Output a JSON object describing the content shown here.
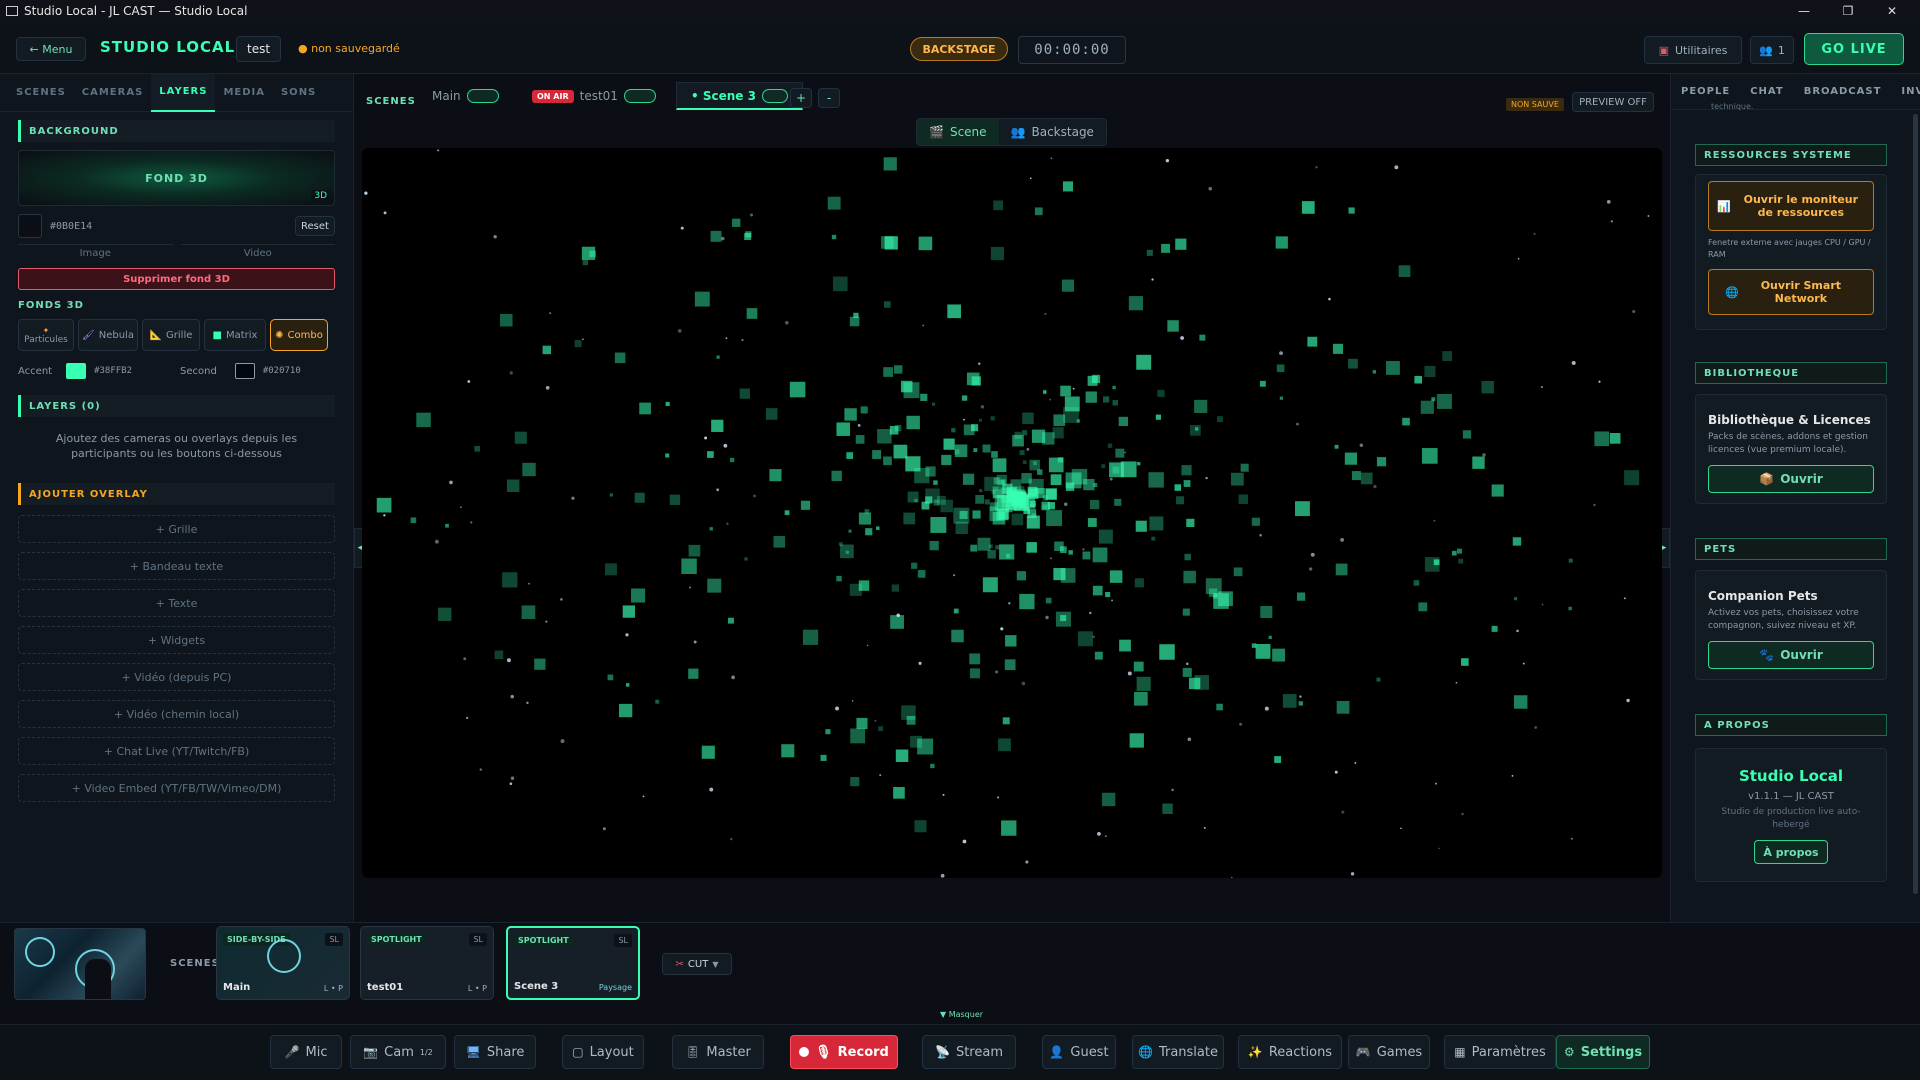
{
  "window": {
    "title": "Studio Local - JL CAST — Studio Local"
  },
  "topbar": {
    "menu_label": "← Menu",
    "brand": "STUDIO LOCAL",
    "project": "test",
    "save_status": "● non sauvegardé",
    "backstage": "BACKSTAGE",
    "timer": "00:00:00",
    "utilities": "Utilitaires",
    "people_count": "1",
    "go_live": "GO LIVE"
  },
  "left": {
    "tabs": [
      "SCENES",
      "CAMERAS",
      "LAYERS",
      "MEDIA",
      "SONS"
    ],
    "active_tab": "LAYERS",
    "background_header": "BACKGROUND",
    "bg_preview_label": "FOND 3D",
    "bg_preview_badge": "3D",
    "bg_color_hex": "#0B0E14",
    "reset_label": "Reset",
    "image_label": "Image",
    "video_label": "Video",
    "remove_3d": "Supprimer fond 3D",
    "fonds_header": "FONDS 3D",
    "fonds": [
      "Particules",
      "Nebula",
      "Grille",
      "Matrix",
      "Combo"
    ],
    "accent_label": "Accent",
    "accent_hex": "#38FFB2",
    "second_label": "Second",
    "second_hex": "#020710",
    "layers_header": "LAYERS (0)",
    "layers_empty": "Ajoutez des cameras ou overlays depuis les participants ou les boutons ci-dessous",
    "overlay_header": "AJOUTER OVERLAY",
    "overlays": [
      "+ Grille",
      "+ Bandeau texte",
      "+ Texte",
      "+ Widgets",
      "+ Vidéo (depuis PC)",
      "+ Vidéo (chemin local)",
      "+ Chat Live (YT/Twitch/FB)",
      "+ Video Embed (YT/FB/TW/Vimeo/DM)"
    ]
  },
  "center": {
    "scenes_label": "SCENES",
    "scene_tabs": [
      {
        "name": "Main"
      },
      {
        "name": "test01",
        "on_air": "ON AIR"
      },
      {
        "name": "• Scene 3"
      }
    ],
    "add_label": "+",
    "remove_label": "-",
    "non_sauve": "NON SAUVE",
    "preview_off": "PREVIEW OFF",
    "toggle_scene": "Scene",
    "toggle_backstage": "Backstage"
  },
  "right": {
    "tabs": [
      "PEOPLE",
      "CHAT",
      "BROADCAST",
      "INVIT"
    ],
    "top_snippet": "technique.",
    "res_header": "RESSOURCES SYSTEME",
    "monitor_btn": "Ouvrir le moniteur de ressources",
    "monitor_desc": "Fenetre externe avec jauges CPU / GPU / RAM",
    "smart_network_btn": "Ouvrir Smart Network",
    "lib_header": "BIBLIOTHEQUE",
    "lib_title": "Bibliothèque & Licences",
    "lib_desc": "Packs de scènes, addons et gestion licences (vue premium locale).",
    "open_label": "Ouvrir",
    "pets_header": "PETS",
    "pets_title": "Companion Pets",
    "pets_desc": "Activez vos pets, choisissez votre compagnon, suivez niveau et XP.",
    "about_header": "A PROPOS",
    "about_title": "Studio Local",
    "about_version": "v1.1.1 — JL CAST",
    "about_desc": "Studio de production live auto-hebergé",
    "about_btn": "À propos"
  },
  "strip": {
    "scenes_label": "SCENES",
    "cards": [
      {
        "tag": "SIDE-BY-SIDE",
        "badge": "SL",
        "name": "Main",
        "lp": "L • P"
      },
      {
        "tag": "SPOTLIGHT",
        "badge": "SL",
        "name": "test01",
        "lp": "L • P"
      },
      {
        "tag": "SPOTLIGHT",
        "badge": "SL",
        "name": "Scene 3",
        "lp": "Paysage"
      }
    ],
    "cut": "CUT",
    "masquer": "▼ Masquer"
  },
  "bottombar": {
    "mic": "Mic",
    "cam": "Cam",
    "cam_sup": "1/2",
    "share": "Share",
    "layout": "Layout",
    "master": "Master",
    "record": "Record",
    "stream": "Stream",
    "guest": "Guest",
    "translate": "Translate",
    "reactions": "Reactions",
    "games": "Games",
    "parametres": "Paramètres",
    "settings": "Settings"
  },
  "colors": {
    "accent": "#38FFB2",
    "record": "#d62839",
    "warning": "#f5a623"
  }
}
